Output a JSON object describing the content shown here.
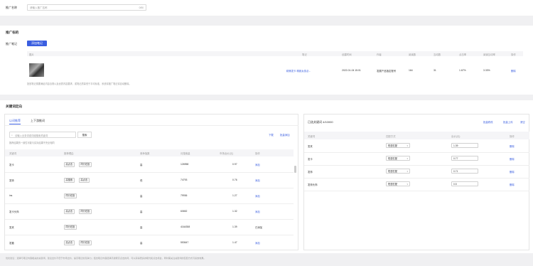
{
  "top": {
    "field_label": "推广名称",
    "input_placeholder": "请输入推广名称",
    "counter": "0/50"
  },
  "promo": {
    "section_title": "推广标的",
    "row_label": "推广笔记",
    "add_button": "添加笔记",
    "table_headers": [
      "图片",
      "笔记",
      "创建时间",
      "作者",
      "阅读数",
      "互动数",
      "点击率",
      "阅读互动率",
      "操作"
    ],
    "row": {
      "note": "精美发卡 精致女孩必...",
      "created": "2022-01-04 15:01",
      "author": "发展产品指定账号",
      "reads": "164",
      "interactions": "31",
      "ctr": "1.67%",
      "ir": "3.33%",
      "action": "删除"
    },
    "hint": "投放笔记需要满足内容合规以及优质内容要求，或笔记质量低于平均标准，系统将推广笔记将自动删除。"
  },
  "kw": {
    "section_title": "关键词定向",
    "tabs": [
      "以词推荐",
      "上下游推词"
    ],
    "search_placeholder": "请输入业务词或词组搜索关键词",
    "search_button": "搜索",
    "actions": [
      "下载",
      "批量添加"
    ],
    "note": "推荐结果的一致性可能与实际结果不完全相同",
    "headers": [
      "关键词",
      "推荐理由",
      "竞争指数",
      "月搜索量",
      "市场出价(元)",
      "操作"
    ],
    "rows": [
      {
        "kw": "发卡",
        "tags": [
          "高点击",
          "同行在投"
        ],
        "comp": "高",
        "vol": "126958",
        "bid": "0.97",
        "op": "添加"
      },
      {
        "kw": "发饰",
        "tags": [
          "高搜索",
          "高点击"
        ],
        "comp": "低",
        "vol": "74793",
        "bid": "0.76",
        "op": "添加"
      },
      {
        "kw": "ins",
        "tags": [
          "同行在投"
        ],
        "comp": "高",
        "vol": "79936",
        "bid": "1.27",
        "op": "添加"
      },
      {
        "kw": "发卡头饰",
        "tags": [
          "高点击",
          "同行在投"
        ],
        "comp": "高",
        "vol": "60652",
        "bid": "1.32",
        "op": "添加"
      },
      {
        "kw": "发夹",
        "tags": [
          "同行在投"
        ],
        "comp": "高",
        "vol": "4164358",
        "bid": "1.39",
        "op": "已添加"
      },
      {
        "kw": "发箍",
        "tags": [
          "高点击",
          "同行在投"
        ],
        "comp": "高",
        "vol": "553647",
        "bid": "1.47",
        "op": "添加"
      }
    ]
  },
  "selected": {
    "title": "已选关键词 4/10000",
    "actions": [
      "批量修改",
      "批量上传",
      "清空"
    ],
    "headers": [
      "关键词",
      "匹配方式",
      "出价(元)",
      "操作"
    ],
    "rows": [
      {
        "kw": "发夹",
        "match": "短语匹配",
        "bid": "1.39",
        "op": "删除"
      },
      {
        "kw": "发卡",
        "match": "短语匹配",
        "bid": "0.77",
        "op": "删除"
      },
      {
        "kw": "发饰",
        "match": "短语匹配",
        "bid": "0.71",
        "op": "删除"
      },
      {
        "kw": "发饰头饰",
        "match": "短语匹配",
        "bid": "0.5",
        "op": "删除"
      }
    ]
  },
  "footer": "优化建议：选择与笔记内容相关的关键词，建议出价不低于市场出价，提高笔记的竞争力；结合笔记内容选择高搜索高点击的词，可以获得更多的曝光和点击机会，同时需关注关键词的匹配方式与投放效果。"
}
